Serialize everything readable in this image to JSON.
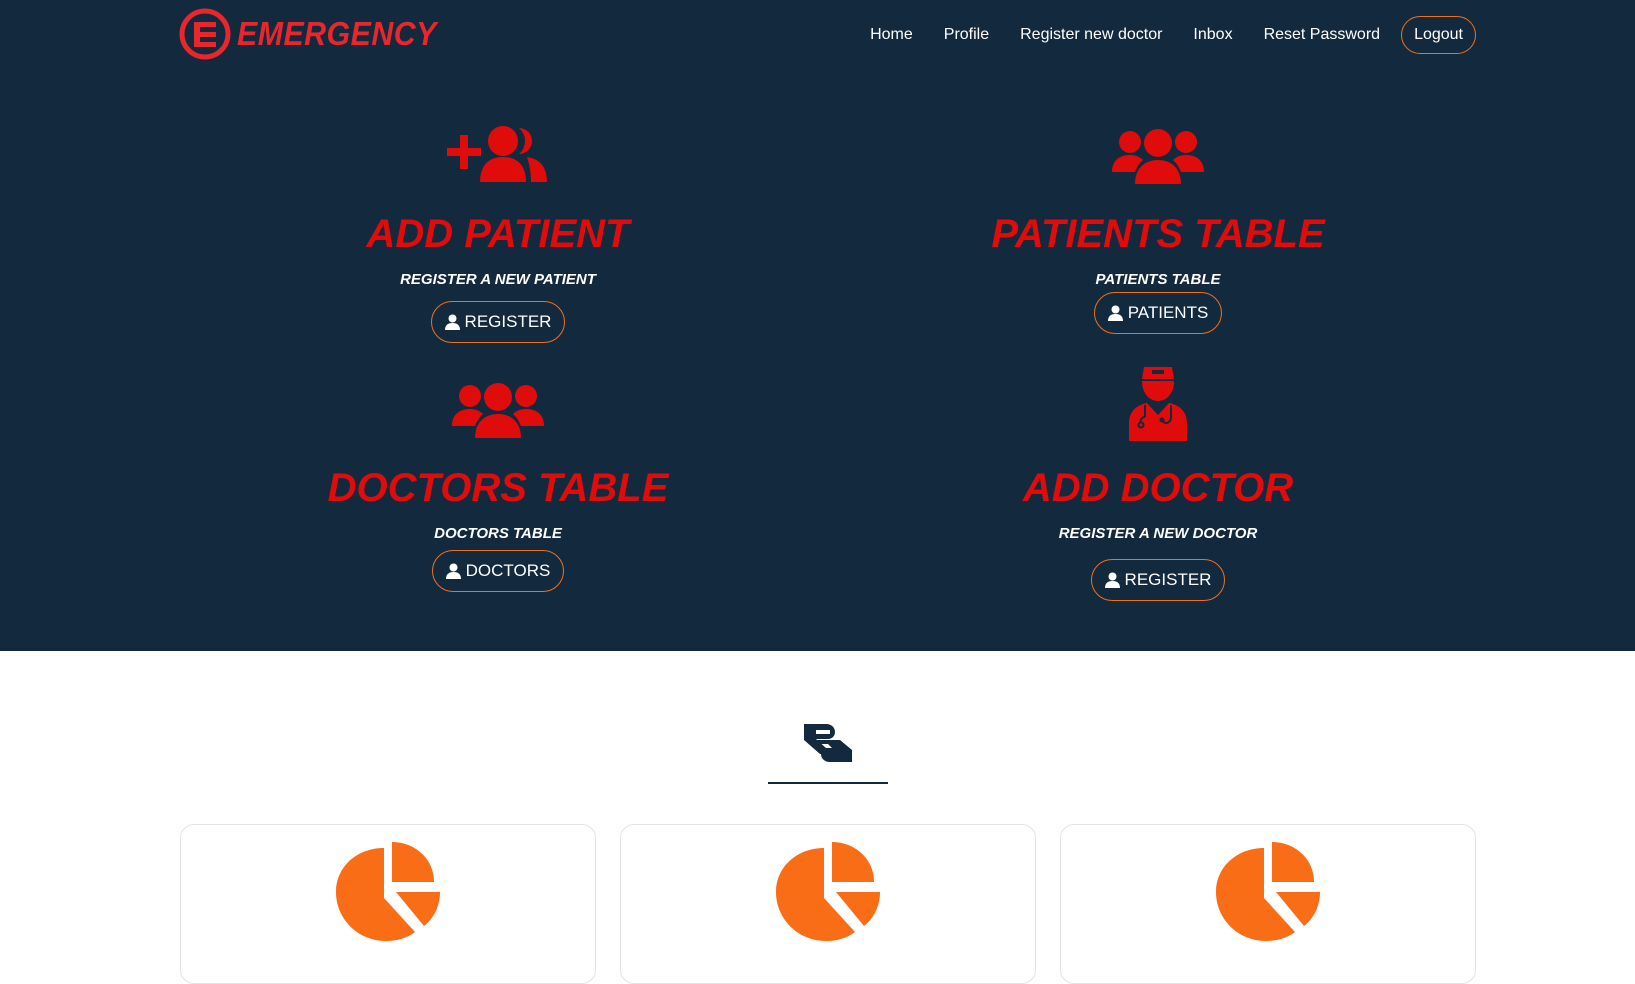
{
  "brand": {
    "name": "EMERGENCY",
    "logo_icon": "emergency-logo-icon",
    "color": "#e8262c"
  },
  "nav": {
    "links": [
      "Home",
      "Profile",
      "Register new doctor",
      "Inbox",
      "Reset Password"
    ],
    "logout_label": "Logout"
  },
  "features": [
    {
      "icon": "user-plus-icon",
      "title": "ADD PATIENT",
      "subtitle": "REGISTER A NEW PATIENT",
      "button_label": "REGISTER",
      "button_icon": "user-icon"
    },
    {
      "icon": "users-icon",
      "title": "PATIENTS TABLE",
      "subtitle": "PATIENTS TABLE",
      "button_label": "PATIENTS",
      "button_icon": "user-icon"
    },
    {
      "icon": "users-icon",
      "title": "DOCTORS TABLE",
      "subtitle": "DOCTORS TABLE",
      "button_label": "DOCTORS",
      "button_icon": "user-icon"
    },
    {
      "icon": "doctor-icon",
      "title": "ADD DOCTOR",
      "subtitle": "REGISTER A NEW DOCTOR",
      "button_label": "REGISTER",
      "button_icon": "user-icon"
    }
  ],
  "section": {
    "icon": "hand-holding-icon"
  },
  "cards": [
    {
      "icon": "pie-chart-icon"
    },
    {
      "icon": "pie-chart-icon"
    },
    {
      "icon": "pie-chart-icon"
    }
  ],
  "colors": {
    "hero_background": "#13293d",
    "accent_red": "#e00b0b",
    "button_border": "#f26f1b",
    "chart_orange": "#f96d16"
  }
}
